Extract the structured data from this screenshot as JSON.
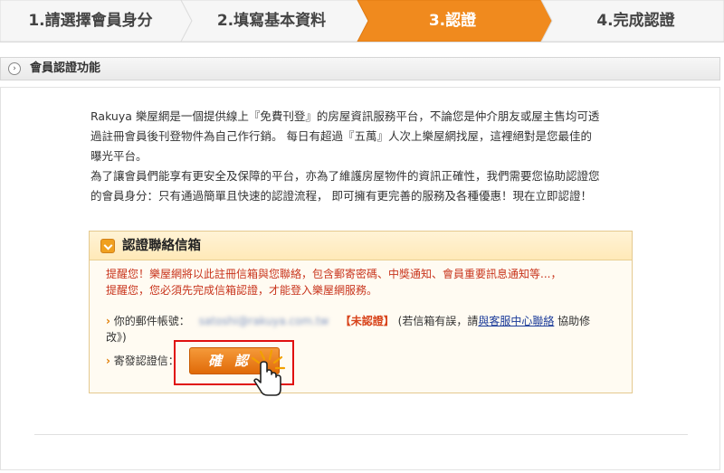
{
  "steps": [
    {
      "label": "1.請選擇會員身分"
    },
    {
      "label": "2.填寫基本資料"
    },
    {
      "label": "3.認證"
    },
    {
      "label": "4.完成認證"
    }
  ],
  "colors": {
    "active_step": "#f08a1e",
    "inactive_step": "#f3f3f3",
    "warning": "#c8341c",
    "highlight_border": "#e01010"
  },
  "section": {
    "title": "會員認證功能",
    "icon": "circle-chevron-icon"
  },
  "intro": {
    "line1": "Rakuya 樂屋網是一個提供線上『免費刊登』的房屋資訊服務平台，不論您是仲介朋友或屋主售均可透",
    "line2": "過註冊會員後刊登物件為自己作行銷。 每日有超過『五萬』人次上樂屋網找屋，這裡絕對是您最佳的",
    "line3": "曝光平台。",
    "line4": "為了讓會員們能享有更安全及保障的平台，亦為了維護房屋物件的資訊正確性，我們需要您協助認證您",
    "line5": "的會員身分：只有通過簡單且快速的認證流程， 即可擁有更完善的服務及各種優惠！現在立即認證！"
  },
  "verify_box": {
    "title": "認證聯絡信箱",
    "warn_line1": "提醒您！樂屋網將以此註冊信箱與您聯絡，包含郵寄密碼、中獎通知、會員重要訊息通知等...，",
    "warn_line2": "提醒您，您必須先完成信箱認證，才能登入樂屋網服務。",
    "email_label": "你的郵件帳號：",
    "email_value": "satoshi@rakuya.com.tw",
    "status": "【未認證】",
    "note_prefix": "(若信箱有誤，請",
    "link_text": "與客服中心聯絡",
    "note_suffix": "協助修",
    "note_line2": "改》)",
    "send_label": "寄發認證信：",
    "confirm_label": "確認"
  }
}
